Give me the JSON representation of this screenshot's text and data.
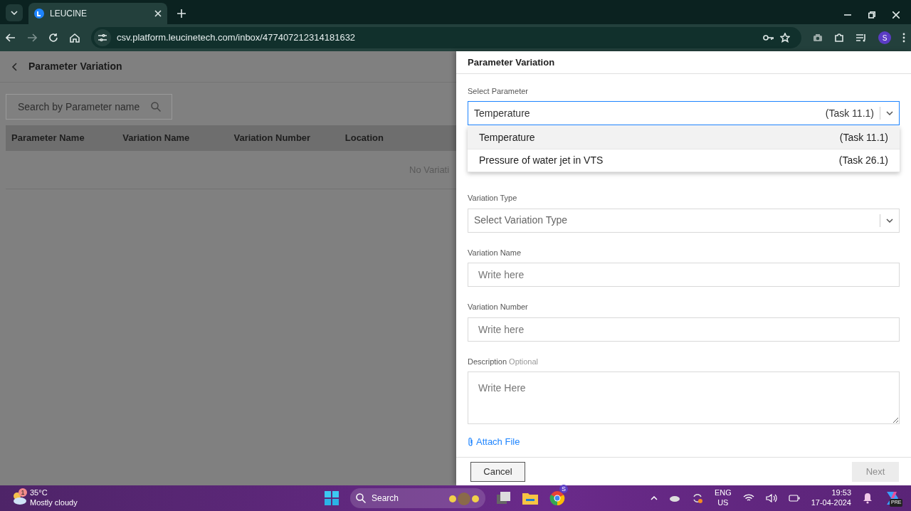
{
  "browser": {
    "tab_title": "LEUCINE",
    "url": "csv.platform.leucinetech.com/inbox/477407212314181632",
    "profile_initial": "S"
  },
  "page": {
    "title": "Parameter Variation",
    "search": {
      "placeholder": "Search by Parameter name"
    },
    "table": {
      "columns": [
        "Parameter Name",
        "Variation Name",
        "Variation Number",
        "Location"
      ],
      "empty_message": "No Variati"
    }
  },
  "drawer": {
    "title": "Parameter Variation",
    "fields": [
      {
        "kind": "select",
        "label": "Select Parameter",
        "value": "Temperature",
        "suffix": "(Task 11.1)",
        "expanded": true,
        "options": [
          {
            "name": "Temperature",
            "task": "(Task 11.1)",
            "selected": true
          },
          {
            "name": "Pressure of water jet in VTS",
            "task": "(Task 26.1)",
            "selected": false
          }
        ]
      },
      {
        "kind": "select",
        "label": "Variation Type",
        "placeholder": "Select Variation Type"
      },
      {
        "kind": "input",
        "label": "Variation Name",
        "placeholder": "Write here"
      },
      {
        "kind": "input",
        "label": "Variation Number",
        "placeholder": "Write here"
      },
      {
        "kind": "textarea",
        "label": "Description",
        "hint": "Optional",
        "placeholder": "Write Here"
      }
    ],
    "attach_link": "Attach File",
    "buttons": [
      {
        "label": "Cancel",
        "disabled": false
      },
      {
        "label": "Next",
        "disabled": true
      }
    ]
  },
  "taskbar": {
    "weather": {
      "temperature": "35°C",
      "condition": "Mostly cloudy",
      "badge": "1"
    },
    "search": "Search",
    "chrome_badge": "S",
    "copilot_badge": "PRE",
    "language": "ENG",
    "region": "US",
    "time": "19:53",
    "date": "17-04-2024"
  }
}
